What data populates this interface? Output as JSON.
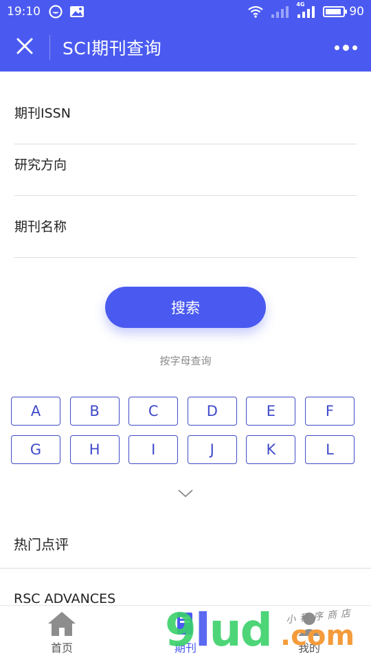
{
  "status_bar": {
    "time": "19:10",
    "battery_level": "90",
    "battery_fill_fraction": 0.9,
    "network_label": "4G",
    "icons": [
      "notification-app-icon",
      "image-icon",
      "wifi-icon",
      "signal-icon",
      "signal-4g-icon",
      "battery-icon"
    ]
  },
  "nav": {
    "close_icon": "close-icon",
    "title": "SCI期刊查询",
    "more_icon": "more-dots-icon"
  },
  "form": {
    "issn_placeholder": "期刊ISSN",
    "direction_placeholder": "研究方向",
    "name_placeholder": "期刊名称",
    "search_label": "搜索"
  },
  "letters": {
    "hint": "按字母查询",
    "items": [
      "A",
      "B",
      "C",
      "D",
      "E",
      "F",
      "G",
      "H",
      "I",
      "J",
      "K",
      "L"
    ],
    "expand_icon": "chevron-down-icon"
  },
  "hot_reviews": {
    "title": "热门点评",
    "items": [
      "RSC ADVANCES"
    ]
  },
  "tab_bar": {
    "tabs": [
      {
        "label": "首页",
        "icon": "home-icon"
      },
      {
        "label": "期刊",
        "icon": "journal-icon"
      },
      {
        "label": "我的",
        "icon": "profile-icon"
      }
    ],
    "active_index": 1
  },
  "watermark": {
    "brand": "9lud",
    "domain_suffix": ".com",
    "tagline": "小程序商店"
  },
  "colors": {
    "primary": "#4a5af0",
    "letter_border": "#3f4ac9",
    "divider": "#dcdcdc",
    "hint": "#8a8a8a"
  }
}
